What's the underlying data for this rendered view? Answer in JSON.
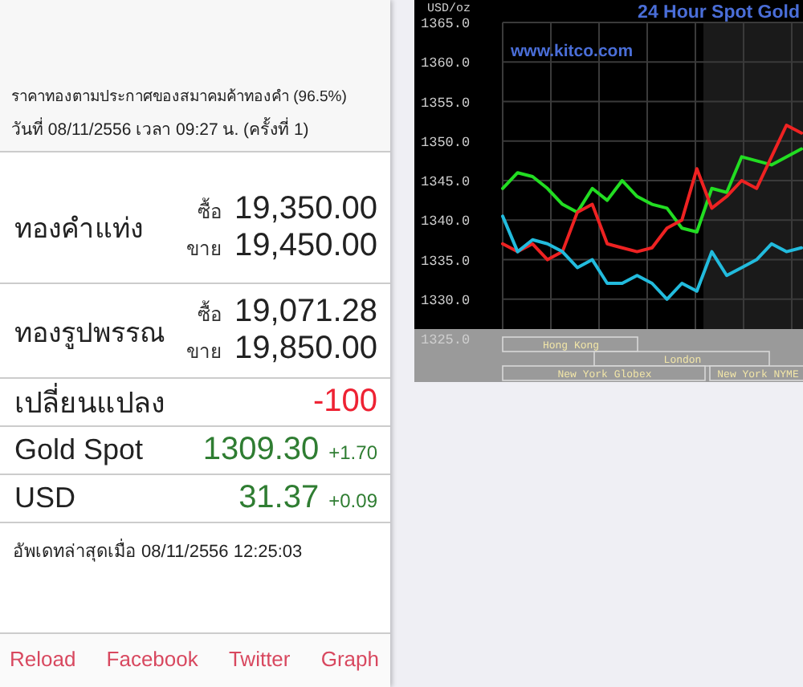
{
  "header": {
    "title": "ราคาทองตามประกาศของสมาคมค้าทองคำ (96.5%)",
    "date_line": "วันที่ 08/11/2556 เวลา 09:27 น. (ครั้งที่ 1)"
  },
  "gold_prices": [
    {
      "name": "ทองคำแท่ง",
      "buy_label": "ซื้อ",
      "buy": "19,350.00",
      "sell_label": "ขาย",
      "sell": "19,450.00"
    },
    {
      "name": "ทองรูปพรรณ",
      "buy_label": "ซื้อ",
      "buy": "19,071.28",
      "sell_label": "ขาย",
      "sell": "19,850.00"
    }
  ],
  "change": {
    "label": "เปลี่ยนแปลง",
    "value": "-100",
    "color": "#ee2233"
  },
  "quotes": [
    {
      "label": "Gold Spot",
      "value": "1309.30",
      "delta": "+1.70",
      "color": "#2f7d32"
    },
    {
      "label": "USD",
      "value": "31.37",
      "delta": "+0.09",
      "color": "#2f7d32"
    }
  ],
  "updated": "อัพเดทล่าสุดเมื่อ 08/11/2556 12:25:03",
  "links": [
    "Reload",
    "Facebook",
    "Twitter",
    "Graph"
  ],
  "chart": {
    "site": "www.kitco.com",
    "sessions": [
      "Hong Kong",
      "London",
      "New York Globex",
      "New York NYME"
    ],
    "chart_data": {
      "type": "line",
      "title": "24 Hour Spot Gold",
      "ylabel": "USD/oz",
      "grid": true,
      "ylim": [
        1325,
        1365
      ],
      "yticks": [
        {
          "value": 1365,
          "label": "1365.0"
        },
        {
          "value": 1360,
          "label": "1360.0"
        },
        {
          "value": 1355,
          "label": "1355.0"
        },
        {
          "value": 1350,
          "label": "1350.0"
        },
        {
          "value": 1345,
          "label": "1345.0"
        },
        {
          "value": 1340,
          "label": "1340.0"
        },
        {
          "value": 1335,
          "label": "1335.0"
        },
        {
          "value": 1330,
          "label": "1330.0"
        },
        {
          "value": 1325,
          "label": "1325.0"
        }
      ],
      "series": [
        {
          "color": "#22dd22",
          "values": [
            1344,
            1346,
            1345.5,
            1344,
            1342,
            1341,
            1344,
            1342.5,
            1345,
            1343,
            1342,
            1341.5,
            1339,
            1338.5,
            1344,
            1343.5,
            1348,
            1347.5,
            1347,
            1348,
            1349
          ]
        },
        {
          "color": "#ee2222",
          "values": [
            1337,
            1336,
            1337,
            1335,
            1336,
            1341,
            1342,
            1337,
            1336.5,
            1336,
            1336.5,
            1339,
            1340,
            1346.5,
            1341.5,
            1343,
            1345,
            1344,
            1348,
            1352,
            1351
          ]
        },
        {
          "color": "#22bbdd",
          "values": [
            1340.5,
            1336,
            1337.5,
            1337,
            1336,
            1334,
            1335,
            1332,
            1332,
            1333,
            1332,
            1330,
            1332,
            1331,
            1336,
            1333,
            1334,
            1335,
            1337,
            1336,
            1336.5
          ]
        }
      ]
    }
  }
}
